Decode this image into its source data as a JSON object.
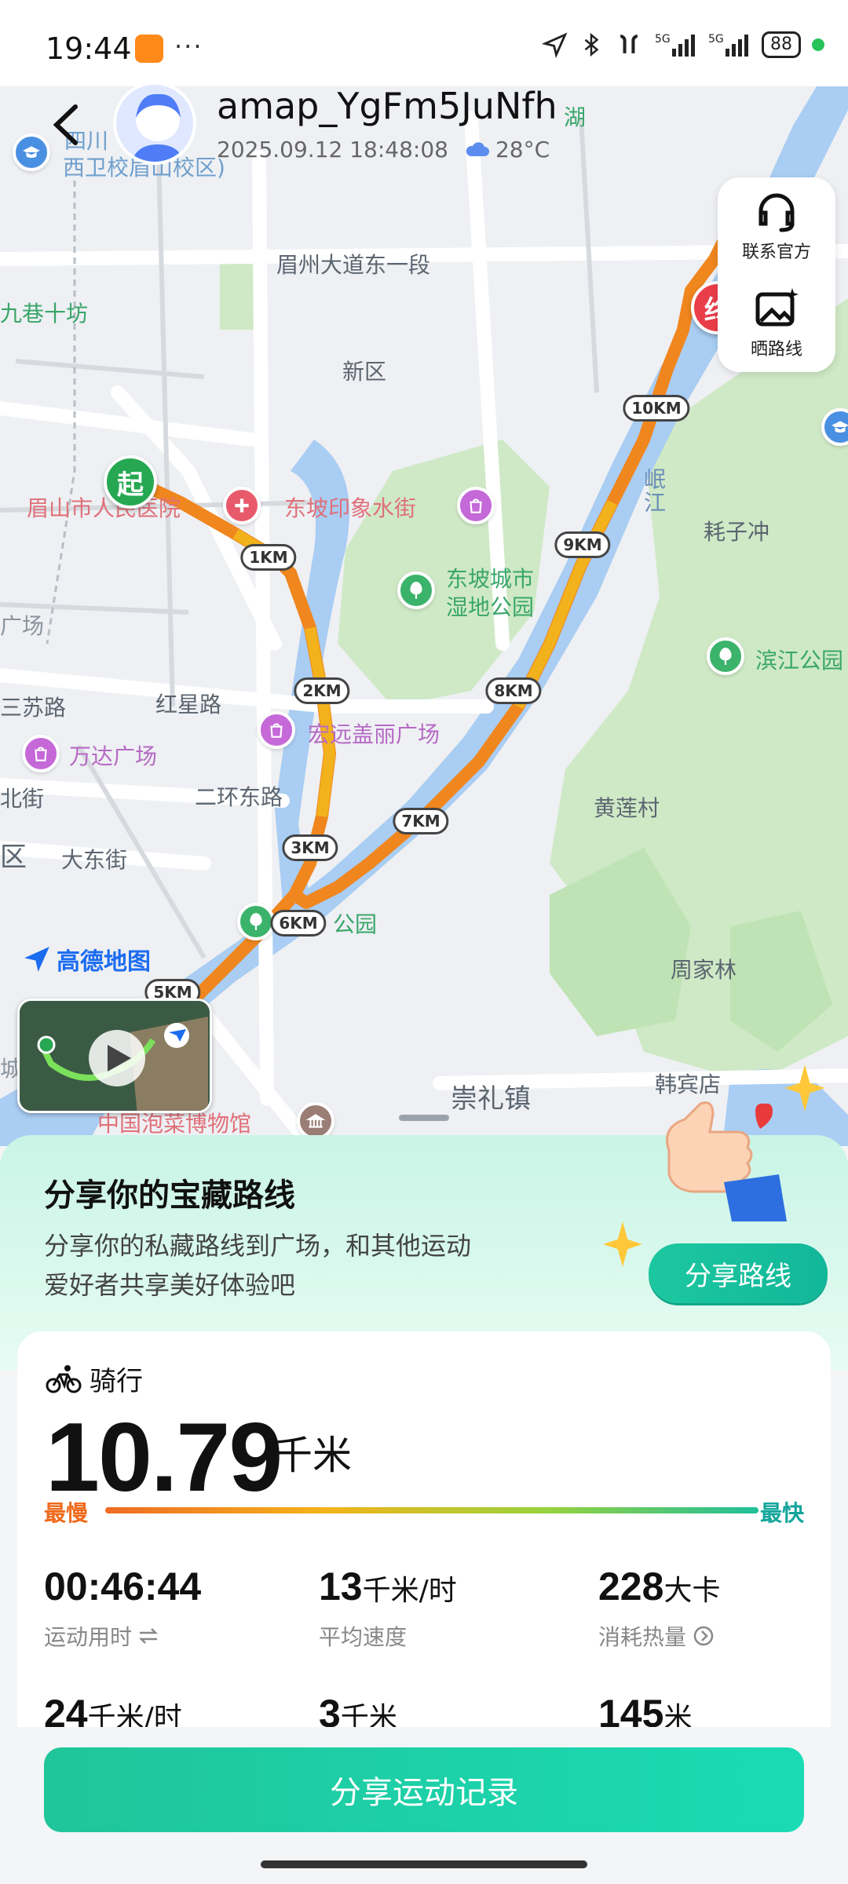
{
  "status_bar": {
    "time": "19:44",
    "dots": "···",
    "battery": "88"
  },
  "header": {
    "username": "amap_YgFm5JuNfh",
    "datetime": "2025.09.12 18:48:08",
    "weather": "28°C"
  },
  "side_buttons": {
    "contact_label": "联系官方",
    "share_route_label": "晒路线"
  },
  "map": {
    "labels": {
      "meizhou_road": "眉州大道东一段",
      "jiuxiang": "九巷十坊",
      "xinqu": "新区",
      "hospital": "眉山市人民医院",
      "dongpo_street": "东坡印象水街",
      "dongpo_city_1": "东坡城市",
      "dongpo_city_2": "湿地公园",
      "minjiang": "岷江",
      "haozichong": "耗子冲",
      "binjiang": "滨江公园",
      "guangchang": "广场",
      "sansu": "三苏路",
      "hongxing": "红星路",
      "hongyuan": "宏远盖丽广场",
      "wanda": "万达广场",
      "beijie": "北街",
      "erhuan": "二环东路",
      "huanglian": "黄莲村",
      "qu": "区",
      "dadong": "大东街",
      "park": "公园",
      "zhoujialin": "周家林",
      "hanbindian": "韩宾店",
      "chonglizhen": "崇礼镇",
      "museum": "中国泡菜博物馆",
      "school_1": "四川",
      "school_2": "西卫校眉山校区)",
      "lake": "湖",
      "cheng": "城"
    },
    "km_markers": [
      "1KM",
      "2KM",
      "3KM",
      "5KM",
      "6KM",
      "7KM",
      "8KM",
      "9KM",
      "10KM"
    ],
    "start_label": "起",
    "end_label": "终",
    "logo_text": "高德地图",
    "route_color_start": "#f0861e",
    "route_color_mid": "#f2b21c"
  },
  "share_card": {
    "title": "分享你的宝藏路线",
    "description_line1": "分享你的私藏路线到广场，和其他运动",
    "description_line2": "爱好者共享美好体验吧",
    "button": "分享路线"
  },
  "stats": {
    "activity": "骑行",
    "distance": "10.79",
    "distance_unit": "千米",
    "slowest": "最慢",
    "fastest": "最快",
    "items": [
      {
        "value": "00:46:44",
        "unit": "",
        "label": "运动用时"
      },
      {
        "value": "13",
        "unit": "千米/时",
        "label": "平均速度"
      },
      {
        "value": "228",
        "unit": "大卡",
        "label": "消耗热量"
      },
      {
        "value": "24",
        "unit": "千米/时",
        "label": ""
      },
      {
        "value": "3",
        "unit": "千米",
        "label": ""
      },
      {
        "value": "145",
        "unit": "米",
        "label": ""
      }
    ]
  },
  "bottom": {
    "share_record": "分享运动记录"
  },
  "colors": {
    "accent": "#1dc8a0",
    "slow": "#ee6a1c",
    "fast": "#13a59a"
  }
}
